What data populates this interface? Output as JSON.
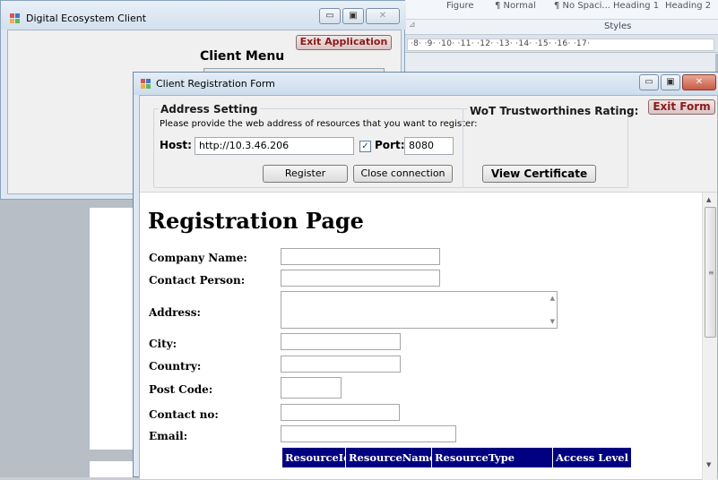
{
  "background_app": {
    "ribbon_items": [
      "Figure",
      "¶ Normal",
      "¶ No Spaci...",
      "Heading 1",
      "Heading 2"
    ],
    "styles_label": "Styles",
    "ruler_text": "·8· ·9· ·10· ·11· ·12· ·13· ·14· ·15· ·16· ·17·"
  },
  "main_window": {
    "title": "Digital Ecosystem Client",
    "minimize": "▭",
    "maximize": "▣",
    "close": "✕",
    "exit_button": "Exit Application",
    "menu_title": "Client Menu"
  },
  "registration_window": {
    "title": "Client Registration Form",
    "minimize": "▭",
    "maximize": "▣",
    "close": "✕",
    "exit_button": "Exit Form",
    "address": {
      "group_title": "Address Setting",
      "instruction": "Please provide the web address of resources that you want to register:",
      "host_label": "Host:",
      "host_value": "http://10.3.46.206",
      "port_checked": true,
      "port_label": "Port:",
      "port_value": "8080",
      "register_button": "Register",
      "close_connection_button": "Close connection"
    },
    "wot": {
      "group_title": "WoT Trustworthines Rating:",
      "view_certificate_button": "View Certificate"
    }
  },
  "web_page": {
    "title": "Registration Page",
    "fields": [
      {
        "label": "Company Name:"
      },
      {
        "label": "Contact Person:"
      },
      {
        "label": "Address:"
      },
      {
        "label": "City:"
      },
      {
        "label": "Country:"
      },
      {
        "label": "Post Code:"
      },
      {
        "label": "Contact no:"
      },
      {
        "label": "Email:"
      }
    ],
    "table_headers": [
      "ResourceId",
      "ResourceName",
      "ResourceType",
      "Access Level"
    ]
  },
  "colors": {
    "table_header_bg": "#000080",
    "exit_text": "#8b1a1a"
  }
}
